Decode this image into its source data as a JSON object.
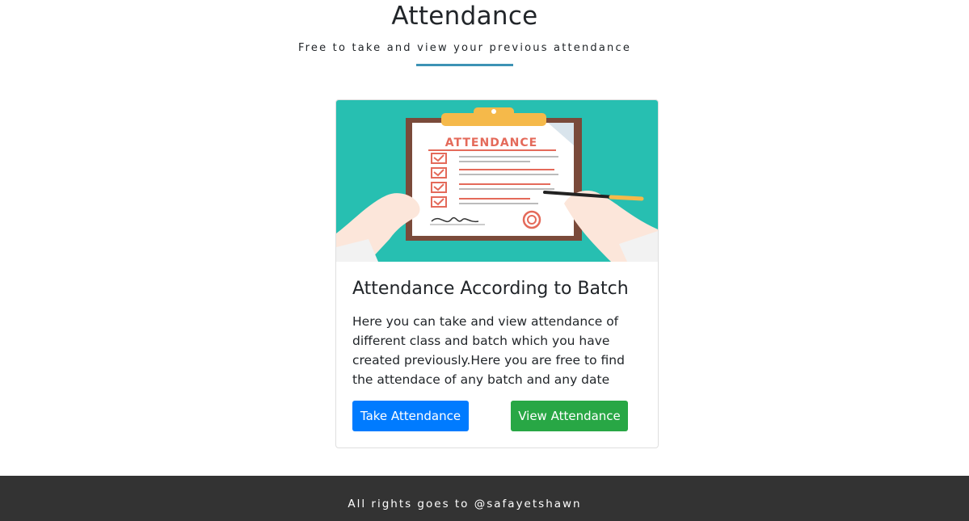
{
  "header": {
    "title": "Attendance",
    "subtitle": "Free to take and view your previous attendance"
  },
  "card": {
    "image_heading": "ATTENDANCE",
    "title": "Attendance According to Batch",
    "text": "Here you can take and view attendance of different class and batch which you have created previously.Here you are free to find the attendace of any batch and any date",
    "take_button_label": "Take Attendance",
    "view_button_label": "View Attendance"
  },
  "footer": {
    "text": "All rights goes to @safayetshawn"
  },
  "colors": {
    "underline": "#3d93b5",
    "image_background": "#27bfb1",
    "take_button": "#007bff",
    "view_button": "#28a745",
    "footer_background": "#333333"
  }
}
